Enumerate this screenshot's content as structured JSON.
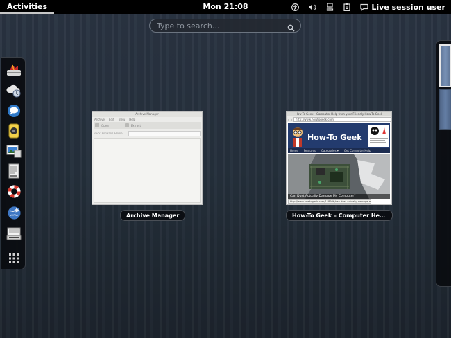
{
  "topbar": {
    "activities": "Activities",
    "clock": "Mon 21:08",
    "tray_icons": [
      "accessibility-icon",
      "volume-icon",
      "network-icon",
      "clipboard-battery-icon"
    ],
    "user": "Live session user"
  },
  "search": {
    "placeholder": "Type to search..."
  },
  "dash": {
    "items": [
      {
        "name": "dash-item-software-installer",
        "icon": "package-icon"
      },
      {
        "name": "dash-item-backup",
        "icon": "backup-icon"
      },
      {
        "name": "dash-item-messaging",
        "icon": "chat-icon"
      },
      {
        "name": "dash-item-music",
        "icon": "speaker-icon"
      },
      {
        "name": "dash-item-photos",
        "icon": "photo-viewer-icon"
      },
      {
        "name": "dash-item-documents",
        "icon": "document-icon"
      },
      {
        "name": "dash-item-help",
        "icon": "lifebuoy-icon"
      },
      {
        "name": "dash-item-web-browser",
        "icon": "globe-icon"
      },
      {
        "name": "dash-item-install",
        "icon": "installer-icon"
      },
      {
        "name": "dash-item-show-apps",
        "icon": "apps-grid-icon"
      }
    ]
  },
  "windows": [
    {
      "caption": "Archive Manager",
      "thumb": {
        "title": "Archive Manager",
        "menu": [
          "Archive",
          "Edit",
          "View",
          "Help"
        ],
        "toolbar_label": "Open",
        "toolbar_extract": "Extract",
        "nav": [
          "Back",
          "Forward",
          "Home"
        ]
      }
    },
    {
      "caption": "How-To Geek – Computer Help fro...",
      "thumb": {
        "title": "How-To Geek – Computer Help from your Friendly How-To Geek",
        "url": "http://www.howtogeek.com/",
        "logo": "How-To Geek",
        "nav": [
          "Home",
          "Features",
          "Categories ▾",
          "Get Computer Help"
        ],
        "headline": "Can Dust Actually Damage My Computer?",
        "status": "http://www.howtogeek.com/118936/can-dust-actually-damage-my-computer/"
      }
    }
  ],
  "colors": {
    "topbar": "#000000",
    "background": "#25303c",
    "dash": "#0a0c10",
    "htg_blue": "#233b6e"
  }
}
